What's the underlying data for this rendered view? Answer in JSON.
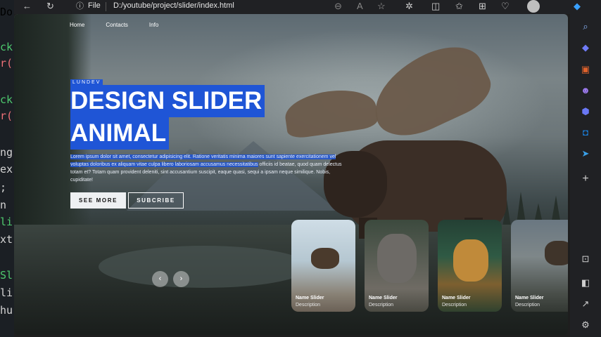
{
  "editor": {
    "lines": [
      {
        "text": "Do",
        "color": "#d4d4d4"
      },
      {
        "text": "ck",
        "color": "#4ec96e"
      },
      {
        "text": "r(",
        "color": "#f07178"
      },
      {
        "text": "ck",
        "color": "#4ec96e"
      },
      {
        "text": "r(",
        "color": "#f07178"
      },
      {
        "text": "ng",
        "color": "#d4d4d4"
      },
      {
        "text": "ex",
        "color": "#d4d4d4"
      },
      {
        "text": ";",
        "color": "#d4d4d4"
      },
      {
        "text": "n",
        "color": "#d4d4d4"
      },
      {
        "text": "li",
        "color": "#4ec96e"
      },
      {
        "text": "xt",
        "color": "#d4d4d4"
      },
      {
        "text": "Sl",
        "color": "#4ec96e"
      },
      {
        "text": "li",
        "color": "#d4d4d4"
      },
      {
        "text": "hu",
        "color": "#d4d4d4"
      }
    ]
  },
  "browser": {
    "file_label": "File",
    "url": "D:/youtube/project/slider/index.html",
    "icons": [
      "back-icon",
      "refresh-icon",
      "info-icon",
      "zoom-out-icon",
      "read-aloud-icon",
      "star-icon",
      "extensions-icon",
      "split-screen-icon",
      "favorites-icon",
      "collections-icon",
      "browser-essentials-icon",
      "profile-icon",
      "copilot-icon"
    ]
  },
  "sidebar": {
    "icons": [
      "search-icon",
      "tag-icon",
      "briefcase-icon",
      "people-icon",
      "copilot-icon",
      "outlook-icon",
      "send-icon",
      "plus-icon",
      "screenshot-icon",
      "sidebar-toggle-icon",
      "external-link-icon",
      "settings-icon"
    ]
  },
  "page": {
    "nav": [
      "Home",
      "Contacts",
      "Info"
    ],
    "tag": "LUNDEV",
    "title_line1": "DESIGN SLIDER",
    "title_line2": "ANIMAL",
    "desc_highlight": "Lorem ipsum dolor sit amet, consectetur adipisicing elit. Ratione veritatis minima maiores sunt sapiente exercitationem vel voluptas doloribus ex aliquam vitae culpa libero laboriosam accusamus necessitatibus",
    "desc_rest": "officiis id beatae, quod quam delectus totam et? Totam quam provident deleniti, sint accusantium suscipit, eaque quasi, sequi a ipsam neque similique. Nobis, cupiditate!",
    "btn_see_more": "SEE MORE",
    "btn_subscribe": "SUBCRIBE",
    "prev_arrow": "‹",
    "next_arrow": "›",
    "thumbnails": [
      {
        "name": "Name Slider",
        "desc": "Description"
      },
      {
        "name": "Name Slider",
        "desc": "Description"
      },
      {
        "name": "Name Slider",
        "desc": "Description"
      },
      {
        "name": "Name Slider",
        "desc": "Description"
      }
    ]
  },
  "colors": {
    "accent": "#1f55d6",
    "browser_bg": "#202124"
  }
}
